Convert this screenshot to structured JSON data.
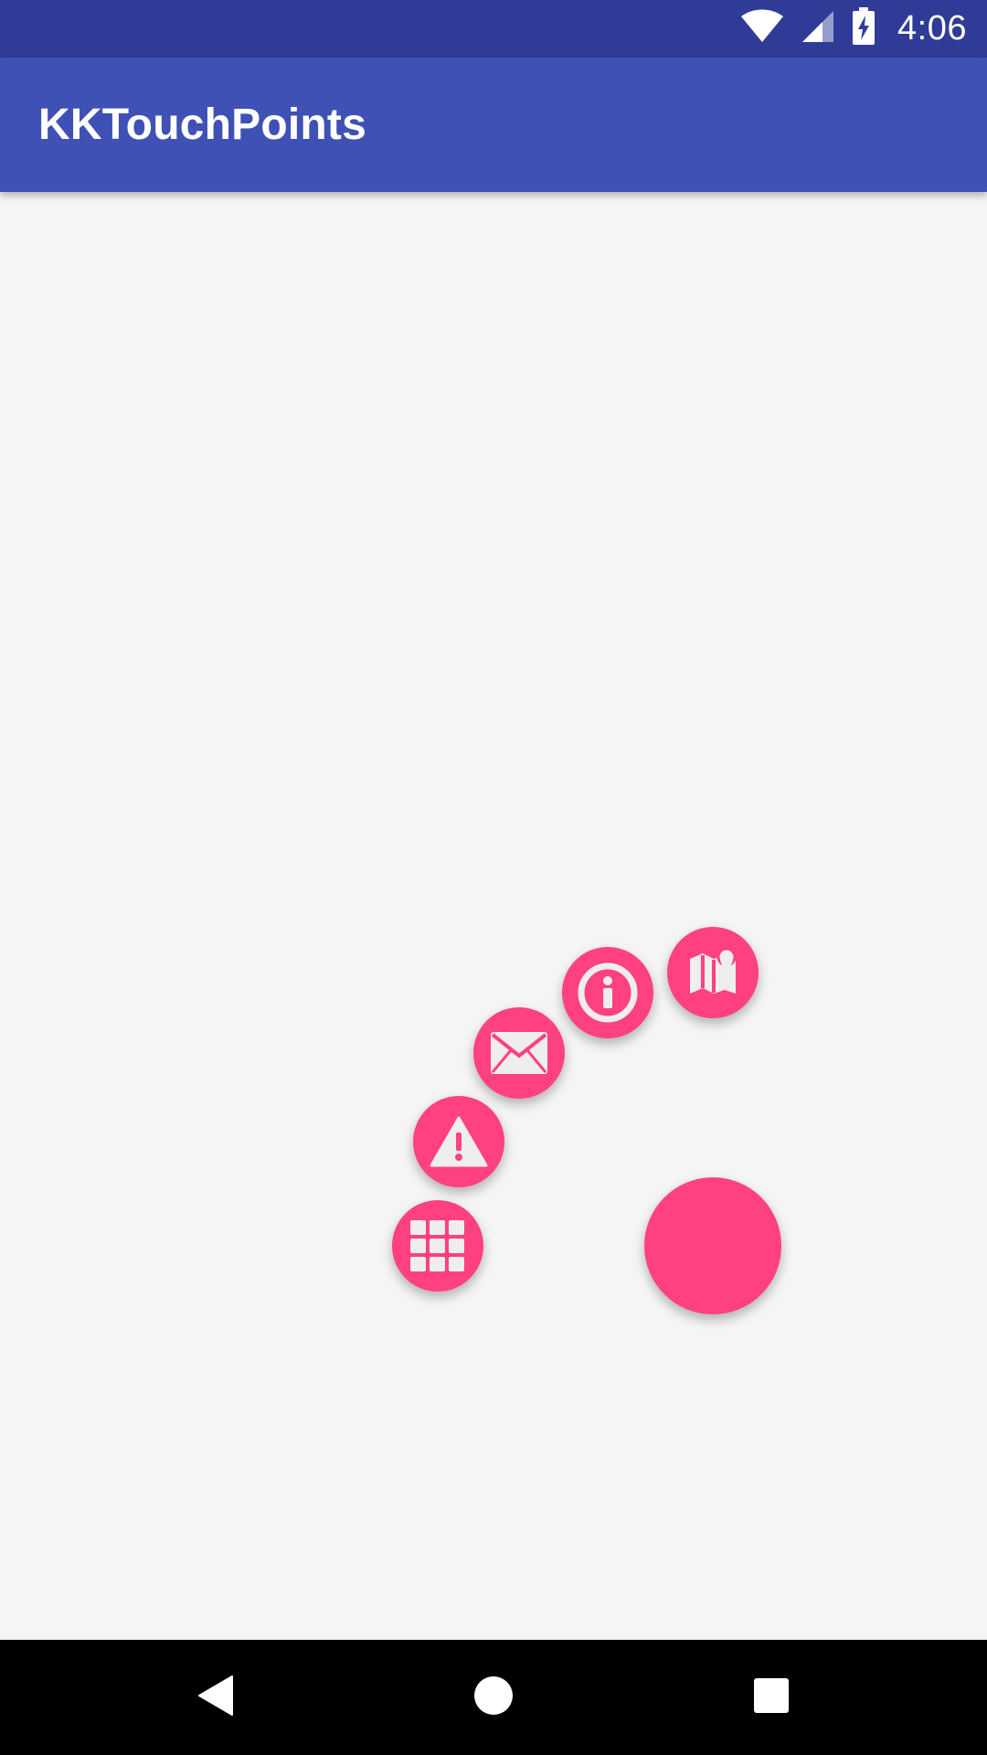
{
  "status_bar": {
    "time": "4:06",
    "icons": [
      "wifi-icon",
      "cellular-signal-icon",
      "battery-charging-icon"
    ]
  },
  "app_bar": {
    "title": "KKTouchPoints"
  },
  "menu": {
    "items": [
      {
        "name": "map-icon"
      },
      {
        "name": "info-icon"
      },
      {
        "name": "mail-icon"
      },
      {
        "name": "warning-icon"
      },
      {
        "name": "grid-icon"
      }
    ],
    "main_button": "touch-point-button"
  },
  "nav_bar": {
    "buttons": [
      "back-icon",
      "home-icon",
      "recents-icon"
    ]
  },
  "colors": {
    "status_bar": "#2f3b96",
    "app_bar": "#3f51b5",
    "accent": "#ff4081",
    "background": "#f5f5f5",
    "icon": "#eeeeee"
  }
}
